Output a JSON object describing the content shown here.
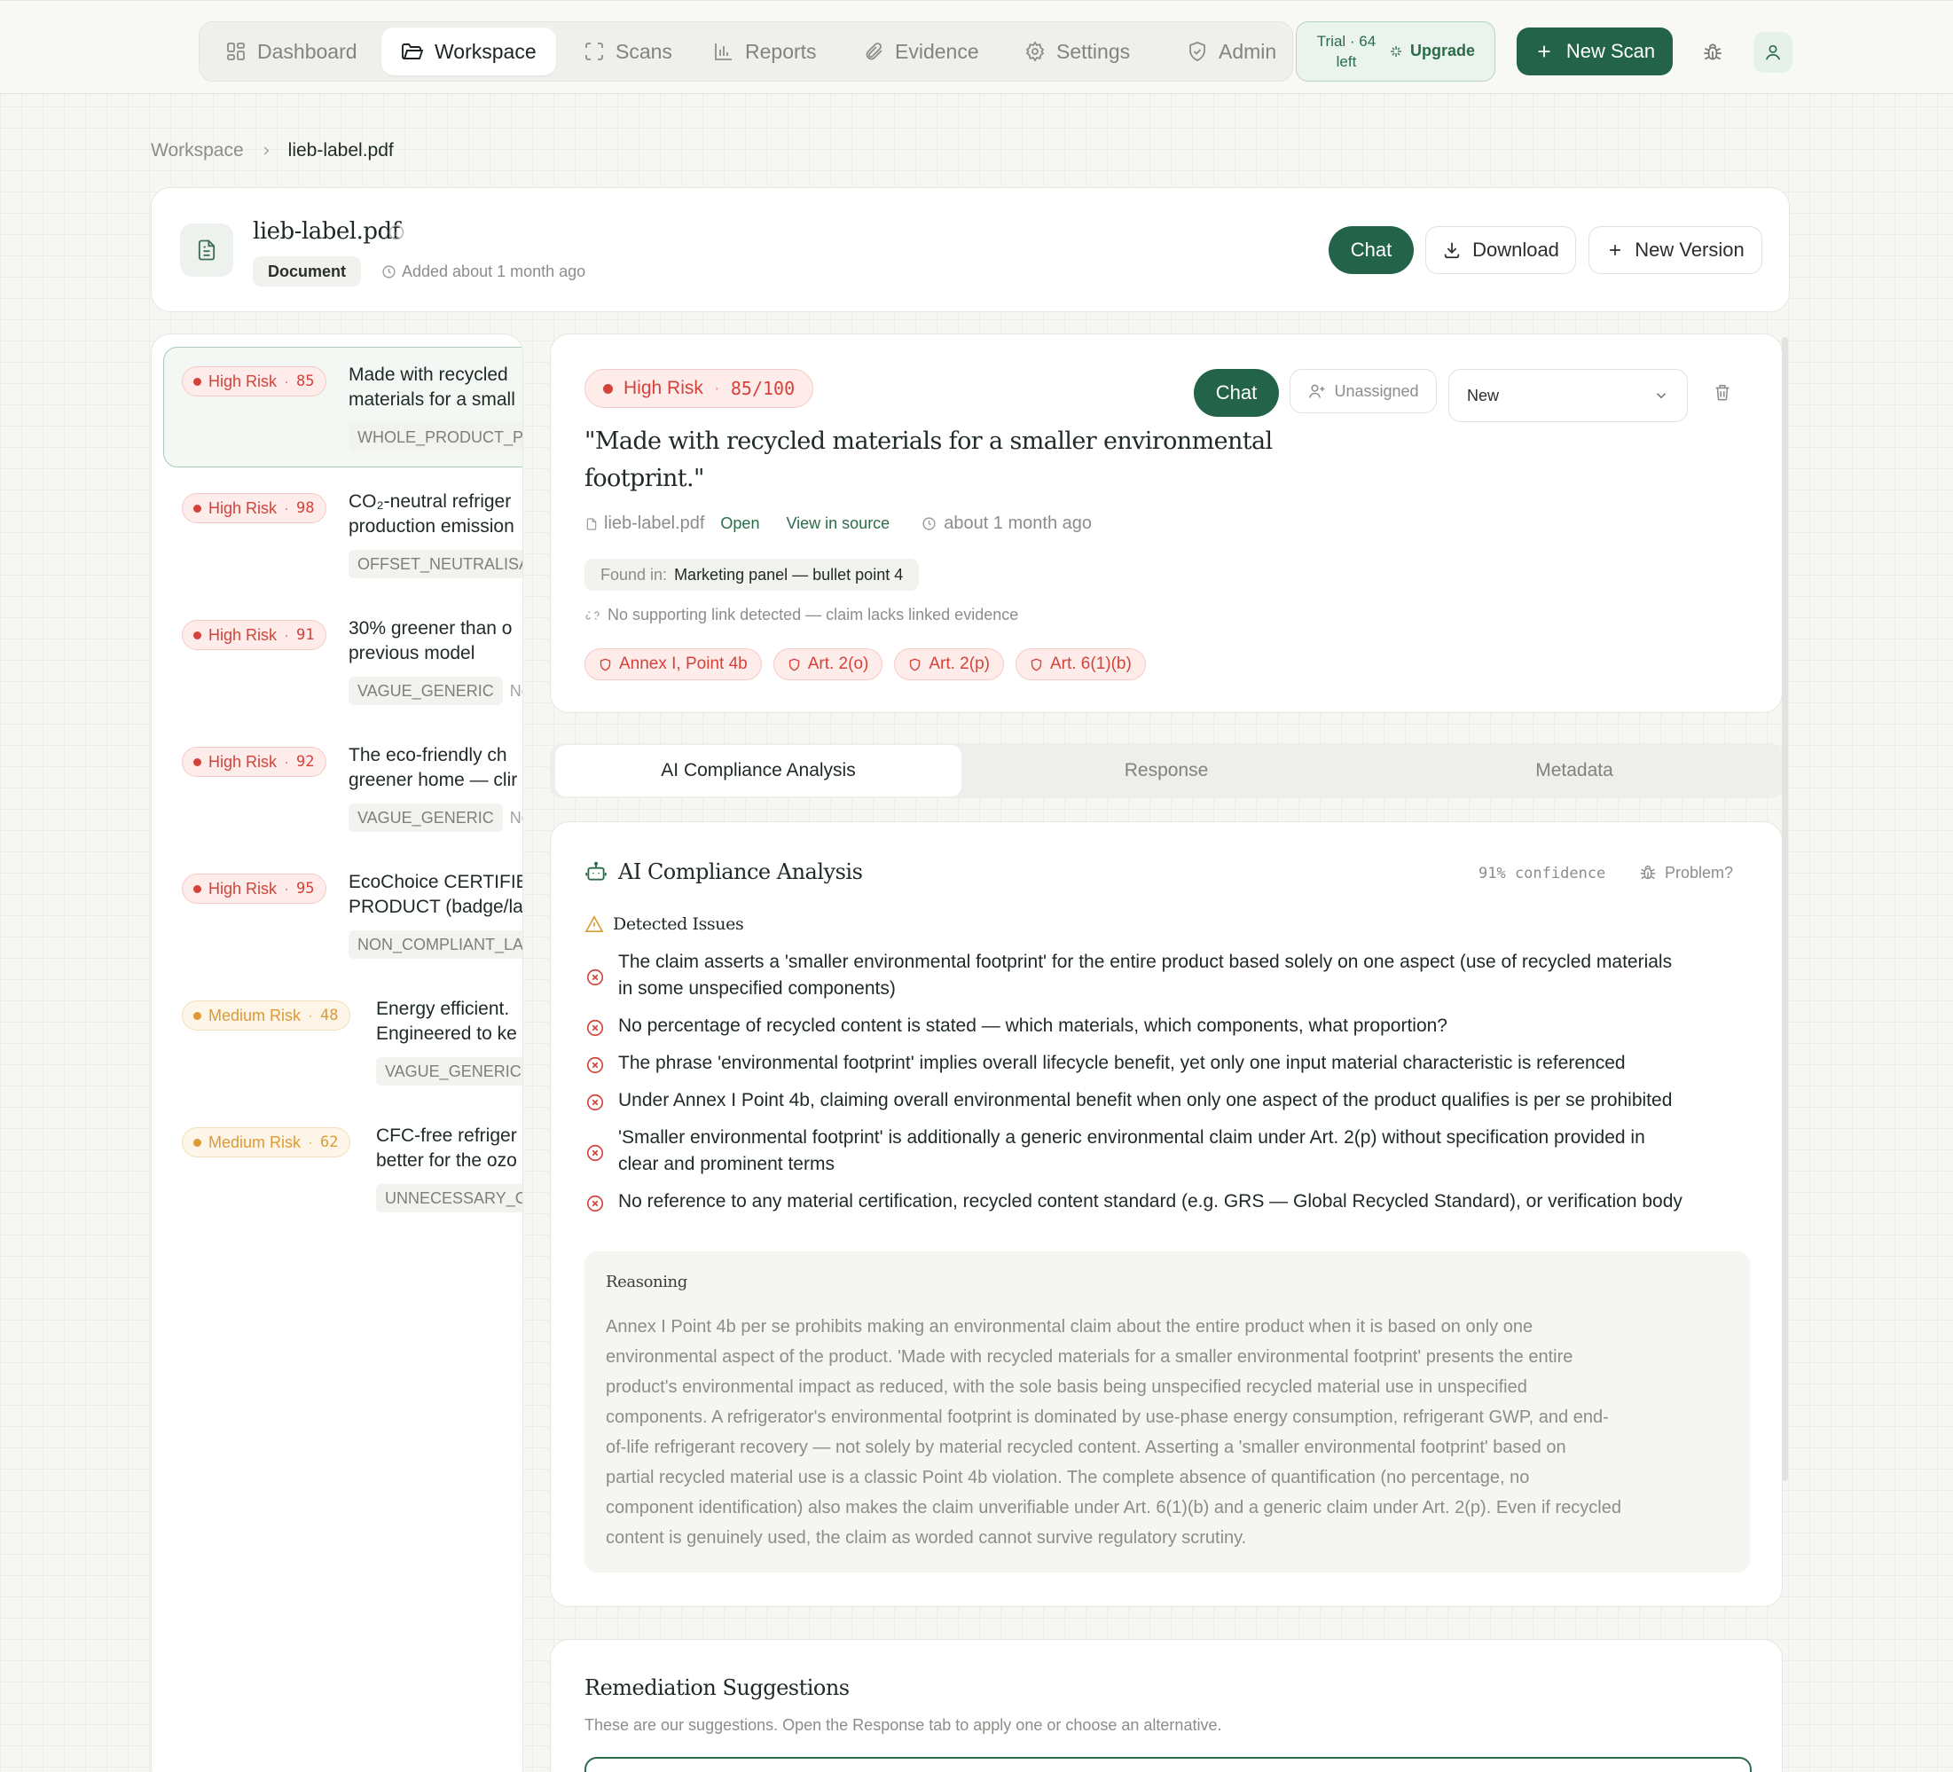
{
  "nav": {
    "items": [
      {
        "label": "Dashboard",
        "icon": "dashboard-icon"
      },
      {
        "label": "Workspace",
        "icon": "folder-icon"
      },
      {
        "label": "Scans",
        "icon": "scan-icon"
      },
      {
        "label": "Reports",
        "icon": "bar-chart-icon"
      },
      {
        "label": "Evidence",
        "icon": "paperclip-icon"
      },
      {
        "label": "Settings",
        "icon": "gear-icon"
      },
      {
        "label": "Admin",
        "icon": "shield-icon"
      }
    ],
    "active": "Workspace",
    "trial_line1": "Trial · 64",
    "trial_line2": "left",
    "upgrade": "Upgrade",
    "new_scan": "New Scan"
  },
  "breadcrumb": {
    "parent": "Workspace",
    "current": "lieb-label.pdf"
  },
  "doc": {
    "title": "lieb-label.pdf",
    "type_badge": "Document",
    "added": "Added about 1 month ago",
    "chat": "Chat",
    "download": "Download",
    "new_version": "New Version"
  },
  "claims": [
    {
      "risk": "High Risk",
      "score": "85",
      "level": "high",
      "line1": "Made with recycled",
      "line2": "materials for a small",
      "category": "WHOLE_PRODUCT_PA",
      "extra": ""
    },
    {
      "risk": "High Risk",
      "score": "98",
      "level": "high",
      "line1": "CO₂-neutral refriger",
      "line2": "production emission",
      "category": "OFFSET_NEUTRALISAT",
      "extra": ""
    },
    {
      "risk": "High Risk",
      "score": "91",
      "level": "high",
      "line1": "30% greener than o",
      "line2": "previous model",
      "category": "VAGUE_GENERIC",
      "extra": "Ne"
    },
    {
      "risk": "High Risk",
      "score": "92",
      "level": "high",
      "line1": "The eco-friendly ch",
      "line2": "greener home — clir",
      "category": "VAGUE_GENERIC",
      "extra": "Ne"
    },
    {
      "risk": "High Risk",
      "score": "95",
      "level": "high",
      "line1": "EcoChoice CERTIFIE",
      "line2": "PRODUCT (badge/la",
      "category": "NON_COMPLIANT_LA",
      "extra": ""
    },
    {
      "risk": "Medium Risk",
      "score": "48",
      "level": "medium",
      "line1": "Energy efficient.",
      "line2": "Engineered to ke",
      "category": "VAGUE_GENERIC",
      "extra": ""
    },
    {
      "risk": "Medium Risk",
      "score": "62",
      "level": "medium",
      "line1": "CFC-free refriger",
      "line2": "better for the ozo",
      "category": "UNNECESSARY_CC",
      "extra": ""
    }
  ],
  "detail": {
    "risk": "High Risk",
    "score": "85/100",
    "chat": "Chat",
    "assignee": "Unassigned",
    "status": "New",
    "quote_line1": "\"Made with recycled materials for a smaller environmental",
    "quote_line2": "footprint.\"",
    "file": "lieb-label.pdf",
    "open": "Open",
    "view_source": "View in source",
    "time": "about 1 month ago",
    "found_label": "Found in:",
    "found_value": "Marketing panel — bullet point 4",
    "no_link": "No supporting link detected — claim lacks linked evidence",
    "articles": [
      "Annex I, Point 4b",
      "Art. 2(o)",
      "Art. 2(p)",
      "Art. 6(1)(b)"
    ]
  },
  "tabs": [
    "AI Compliance Analysis",
    "Response",
    "Metadata"
  ],
  "analysis": {
    "title": "AI Compliance Analysis",
    "confidence": "91% confidence",
    "problem": "Problem?",
    "issues_heading": "Detected Issues",
    "issues": [
      {
        "line1": "The claim asserts a 'smaller environmental footprint' for the entire product based solely on one aspect (use of recycled materials",
        "line2": "in some unspecified components)"
      },
      {
        "line1": "No percentage of recycled content is stated — which materials, which components, what proportion?",
        "line2": ""
      },
      {
        "line1": "The phrase 'environmental footprint' implies overall lifecycle benefit, yet only one input material characteristic is referenced",
        "line2": ""
      },
      {
        "line1": "Under Annex I Point 4b, claiming overall environmental benefit when only one aspect of the product qualifies is per se prohibited",
        "line2": ""
      },
      {
        "line1": "'Smaller environmental footprint' is additionally a generic environmental claim under Art. 2(p) without specification provided in",
        "line2": "clear and prominent terms"
      },
      {
        "line1": "No reference to any material certification, recycled content standard (e.g. GRS — Global Recycled Standard), or verification body",
        "line2": ""
      }
    ],
    "reasoning_title": "Reasoning",
    "reasoning_lines": [
      "Annex I Point 4b per se prohibits making an environmental claim about the entire product when it is based on only one",
      "environmental aspect of the product. 'Made with recycled materials for a smaller environmental footprint' presents the entire",
      "product's environmental impact as reduced, with the sole basis being unspecified recycled material use in unspecified",
      "components. A refrigerator's environmental footprint is dominated by use-phase energy consumption, refrigerant GWP, and end-",
      "of-life refrigerant recovery — not solely by material recycled content. Asserting a 'smaller environmental footprint' based on",
      "partial recycled material use is a classic Point 4b violation. The complete absence of quantification (no percentage, no",
      "component identification) also makes the claim unverifiable under Art. 6(1)(b) and a generic claim under Art. 2(p). Even if recycled",
      "content is genuinely used, the claim as worded cannot survive regulatory scrutiny."
    ]
  },
  "remediation": {
    "title": "Remediation Suggestions",
    "subtitle": "These are our suggestions. Open the Response tab to apply one or choose an alternative."
  },
  "colors": {
    "accent": "#22634a",
    "high": "#d4423a",
    "medium": "#dc9a36"
  }
}
